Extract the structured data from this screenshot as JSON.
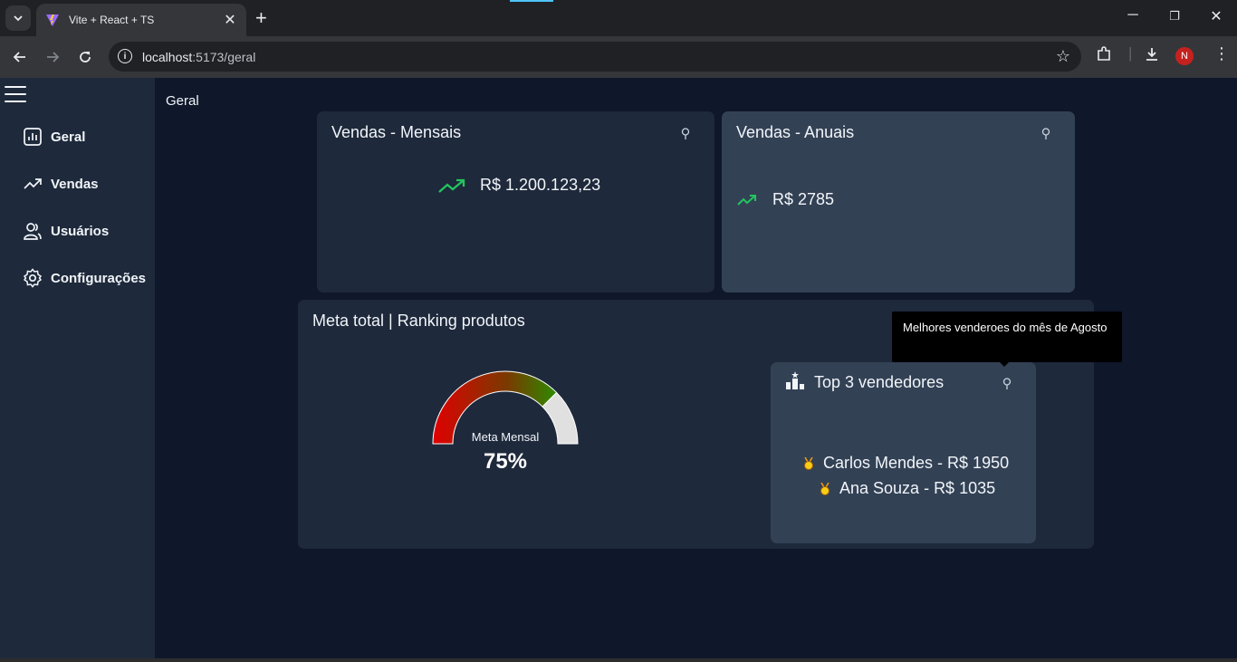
{
  "browser": {
    "tab_title": "Vite + React + TS",
    "url_host": "localhost",
    "url_port_path": ":5173/geral",
    "avatar_letter": "N"
  },
  "sidebar": {
    "items": [
      {
        "label": "Geral",
        "icon": "bar-chart-icon"
      },
      {
        "label": "Vendas",
        "icon": "trending-up-icon"
      },
      {
        "label": "Usuários",
        "icon": "users-icon"
      },
      {
        "label": "Configurações",
        "icon": "gear-icon"
      }
    ]
  },
  "page": {
    "title": "Geral"
  },
  "cards": {
    "monthly": {
      "title": "Vendas - Mensais",
      "value": "R$ 1.200.123,23"
    },
    "yearly": {
      "title": "Vendas - Anuais",
      "value": "R$ 2785"
    },
    "goal": {
      "title": "Meta total | Ranking produtos",
      "gauge_label": "Meta Mensal",
      "gauge_value": "75%",
      "gauge_percent": 75
    },
    "top_sellers": {
      "title": "Top 3 vendedores",
      "tooltip": "Melhores venderoes do mês de Agosto",
      "sellers": [
        {
          "text": "Carlos Mendes - R$ 1950"
        },
        {
          "text": "Ana Souza - R$ 1035"
        }
      ]
    }
  },
  "colors": {
    "background": "#0f172a",
    "sidebar": "#1e293b",
    "card_dark": "#1e293b",
    "card_light": "#334155",
    "trend_green": "#22c55e",
    "gauge_red": "#e00000",
    "gauge_green": "#2e8b00",
    "gauge_rest": "#e0e0e0"
  }
}
